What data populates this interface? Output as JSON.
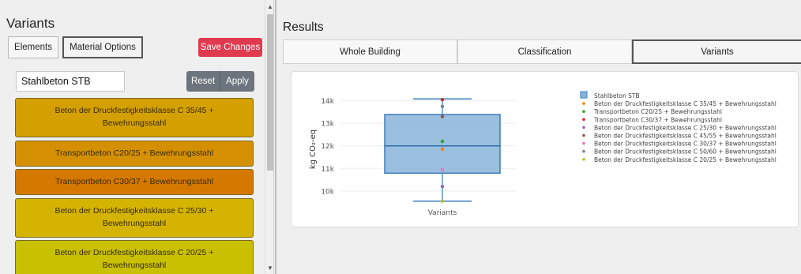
{
  "left": {
    "title": "Variants",
    "tabs": [
      "Elements",
      "Material Options"
    ],
    "save_label": "Save Changes",
    "select_value": "Stahlbeton STB",
    "reset_label": "Reset",
    "apply_label": "Apply",
    "materials": [
      {
        "label": "Beton der Druckfestigkeitsklasse C 35/45 + Bewehrungsstahl",
        "color": "#d4a000"
      },
      {
        "label": "Transportbeton C20/25 + Bewehrungsstahl",
        "color": "#d49000"
      },
      {
        "label": "Transportbeton C30/37 + Bewehrungsstahl",
        "color": "#d47800"
      },
      {
        "label": "Beton der Druckfestigkeitsklasse C 25/30 + Bewehrungsstahl",
        "color": "#d4b400"
      },
      {
        "label": "Beton der Druckfestigkeitsklasse C 20/25 + Bewehrungsstahl",
        "color": "#c8c000"
      }
    ]
  },
  "right": {
    "title": "Results",
    "tabs": [
      "Whole Building",
      "Classification",
      "Variants"
    ],
    "active_tab": "Variants"
  },
  "chart_data": {
    "type": "box",
    "xlabel": "Variants",
    "ylabel": "kg CO₂-eq",
    "ylim": [
      9400,
      14300
    ],
    "yticks": [
      10000,
      11000,
      12000,
      13000,
      14000
    ],
    "yticklabels": [
      "10k",
      "11k",
      "12k",
      "13k",
      "14k"
    ],
    "box": {
      "name": "Stahlbeton STB",
      "min": 9550,
      "q1": 10790,
      "median": 12000,
      "q3": 13390,
      "max": 14080,
      "color": "#5b9bd5"
    },
    "points": [
      {
        "name": "Beton der Druckfestigkeitsklasse C 35/45 + Bewehrungsstahl",
        "value": 11850,
        "color": "#ff7f0e"
      },
      {
        "name": "Transportbeton C20/25 + Bewehrungsstahl",
        "value": 12200,
        "color": "#2ca02c"
      },
      {
        "name": "Transportbeton C30/37 + Bewehrungsstahl",
        "value": 14050,
        "color": "#d62728"
      },
      {
        "name": "Beton der Druckfestigkeitsklasse C 25/30 + Bewehrungsstahl",
        "value": 10200,
        "color": "#9467bd"
      },
      {
        "name": "Beton der Druckfestigkeitsklasse C 45/55 + Bewehrungsstahl",
        "value": 13300,
        "color": "#8c564b"
      },
      {
        "name": "Beton der Druckfestigkeitsklasse C 30/37 + Bewehrungsstahl",
        "value": 10950,
        "color": "#e377c2"
      },
      {
        "name": "Beton der Druckfestigkeitsklasse C 50/60 + Bewehrungsstahl",
        "value": 13750,
        "color": "#7f7f7f"
      },
      {
        "name": "Beton der Druckfestigkeitsklasse C 20/25 + Bewehrungsstahl",
        "value": 9550,
        "color": "#bcbd22"
      }
    ]
  }
}
